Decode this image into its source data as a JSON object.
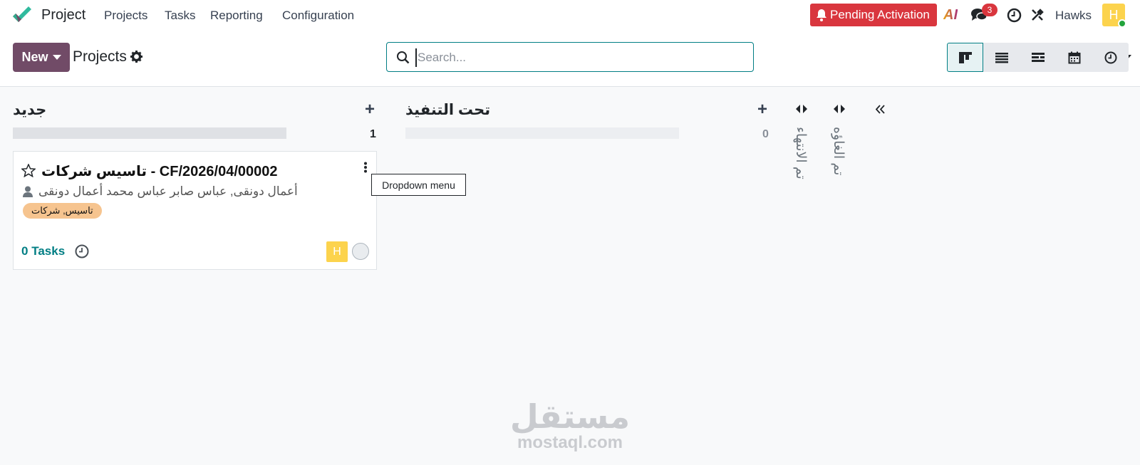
{
  "navbar": {
    "app_name": "Project",
    "menu": [
      "Projects",
      "Tasks",
      "Reporting",
      "Configuration"
    ],
    "pending_activation": "Pending Activation",
    "ai_label": "AI",
    "message_count": "3",
    "user_name": "Hawks",
    "avatar_letter": "H"
  },
  "control_panel": {
    "new_label": "New",
    "breadcrumb": "Projects",
    "search_placeholder": "Search..."
  },
  "kanban": {
    "columns": [
      {
        "title": "جديد",
        "count": "1"
      },
      {
        "title": "تحت التنفيذ",
        "count": "0"
      }
    ],
    "folded_columns": [
      "تم الانتهاء",
      "تم الغاؤه"
    ]
  },
  "card": {
    "title": "تاسيس شركات - CF/2026/04/00002",
    "partner": "أعمال دونقى, عباس صابر عباس محمد أعمال دونقى",
    "tag": "تاسيس, شركات",
    "tasks_count": "0",
    "tasks_label": "Tasks",
    "avatar_letter": "H"
  },
  "tooltip": "Dropdown menu",
  "watermark": {
    "arabic": "مستقل",
    "latin": "mostaql.com"
  },
  "colors": {
    "brand": "#714b67",
    "accent": "#017e84",
    "danger": "#d9363e",
    "tag": "#f6c48f"
  }
}
